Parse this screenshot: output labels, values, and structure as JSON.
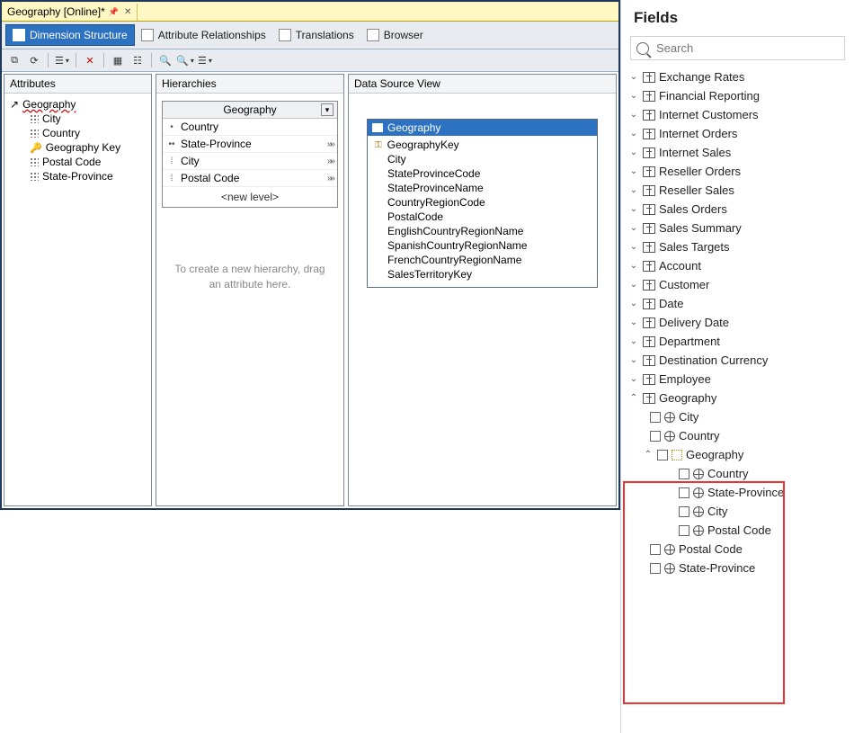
{
  "doc_tab": {
    "title": "Geography [Online]*"
  },
  "mode_tabs": {
    "t0": "Dimension Structure",
    "t1": "Attribute Relationships",
    "t2": "Translations",
    "t3": "Browser"
  },
  "panes": {
    "attributes_title": "Attributes",
    "hierarchies_title": "Hierarchies",
    "dsv_title": "Data Source View"
  },
  "attributes": {
    "root": "Geography",
    "a0": "City",
    "a1": "Country",
    "a2": "Geography Key",
    "a3": "Postal Code",
    "a4": "State-Province"
  },
  "hierarchy": {
    "title": "Geography",
    "l0": "Country",
    "l1": "State-Province",
    "l2": "City",
    "l3": "Postal Code",
    "new_level": "<new level>",
    "hint": "To create a new hierarchy, drag an attribute here."
  },
  "dsv_table": {
    "name": "Geography",
    "c0": "GeographyKey",
    "c1": "City",
    "c2": "StateProvinceCode",
    "c3": "StateProvinceName",
    "c4": "CountryRegionCode",
    "c5": "PostalCode",
    "c6": "EnglishCountryRegionName",
    "c7": "SpanishCountryRegionName",
    "c8": "FrenchCountryRegionName",
    "c9": "SalesTerritoryKey"
  },
  "fields": {
    "title": "Fields",
    "search_placeholder": "Search",
    "tables": {
      "t0": "Exchange Rates",
      "t1": "Financial Reporting",
      "t2": "Internet Customers",
      "t3": "Internet Orders",
      "t4": "Internet Sales",
      "t5": "Reseller Orders",
      "t6": "Reseller Sales",
      "t7": "Sales Orders",
      "t8": "Sales Summary",
      "t9": "Sales Targets",
      "t10": "Account",
      "t11": "Customer",
      "t12": "Date",
      "t13": "Delivery Date",
      "t14": "Department",
      "t15": "Destination Currency",
      "t16": "Employee",
      "t17": "Geography"
    },
    "geo": {
      "f0": "City",
      "f1": "Country",
      "h0": "Geography",
      "h0l0": "Country",
      "h0l1": "State-Province",
      "h0l2": "City",
      "h0l3": "Postal Code",
      "f2": "Postal Code",
      "f3": "State-Province"
    }
  }
}
